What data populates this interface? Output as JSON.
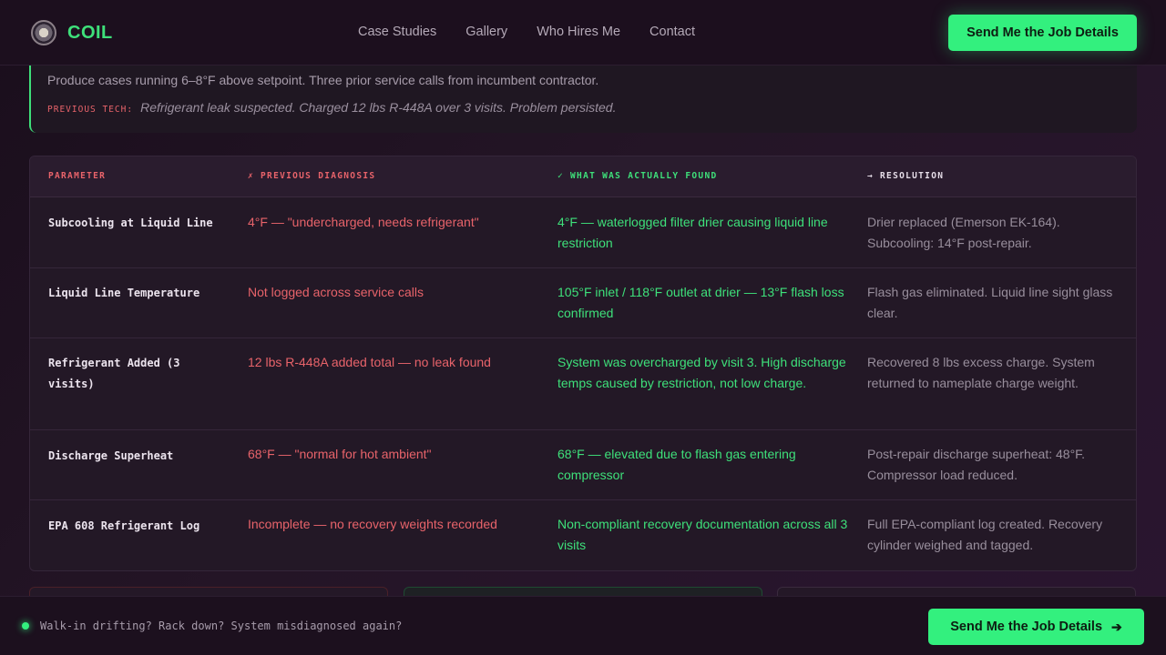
{
  "brand": {
    "name": "COIL",
    "logo_icon": "coil-gauge-icon"
  },
  "nav": {
    "links": [
      "Case Studies",
      "Gallery",
      "Who Hires Me",
      "Contact"
    ],
    "cta_label": "Send Me the Job Details"
  },
  "case": {
    "description": "Produce cases running 6–8°F above setpoint. Three prior service calls from incumbent contractor.",
    "prev_tech_label": "PREVIOUS TECH:",
    "prev_tech_text": "Refrigerant leak suspected. Charged 12 lbs R-448A over 3 visits. Problem persisted."
  },
  "table": {
    "headers": {
      "parameter": "PARAMETER",
      "previous": "✗ PREVIOUS DIAGNOSIS",
      "found": "✓ WHAT WAS ACTUALLY FOUND",
      "resolution": "→ RESOLUTION"
    },
    "rows": [
      {
        "parameter": "Subcooling at Liquid Line",
        "previous": "4°F — \"undercharged, needs refrigerant\"",
        "found": "4°F — waterlogged filter drier causing liquid line restriction",
        "resolution": "Drier replaced (Emerson EK-164). Subcooling: 14°F post-repair."
      },
      {
        "parameter": "Liquid Line Temperature",
        "previous": "Not logged across service calls",
        "found": "105°F inlet / 118°F outlet at drier — 13°F flash loss confirmed",
        "resolution": "Flash gas eliminated. Liquid line sight glass clear."
      },
      {
        "parameter": "Refrigerant Added (3 visits)",
        "previous": "12 lbs R-448A added total — no leak found",
        "found": "System was overcharged by visit 3. High discharge temps caused by restriction, not low charge.",
        "resolution": "Recovered 8 lbs excess charge. System returned to nameplate charge weight."
      },
      {
        "parameter": "Discharge Superheat",
        "previous": "68°F — \"normal for hot ambient\"",
        "found": "68°F — elevated due to flash gas entering compressor",
        "resolution": "Post-repair discharge superheat: 48°F. Compressor load reduced."
      },
      {
        "parameter": "EPA 608 Refrigerant Log",
        "previous": "Incomplete — no recovery weights recorded",
        "found": "Non-compliant recovery documentation across all 3 visits",
        "resolution": "Full EPA-compliant log created. Recovery cylinder weighed and tagged."
      }
    ]
  },
  "sticky": {
    "text": "Walk-in drifting? Rack down? System misdiagnosed again?",
    "cta_label": "Send Me the Job Details",
    "cta_icon": "arrow-right-icon"
  },
  "colors": {
    "accent": "#33f07e",
    "danger": "#e8636a",
    "background": "#1a0e1c"
  }
}
